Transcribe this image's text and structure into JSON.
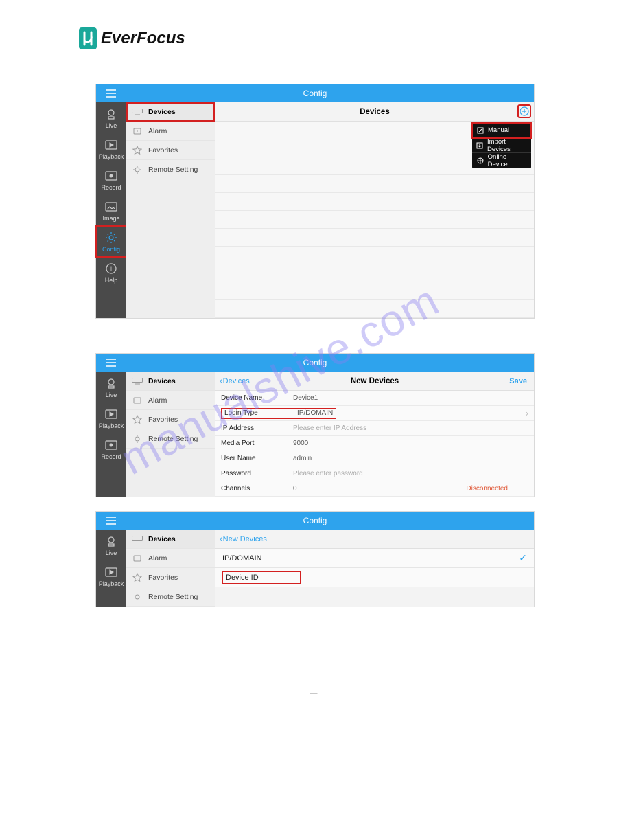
{
  "logo": {
    "text": "EverFocus"
  },
  "watermark": "manualshive.com",
  "app1": {
    "topbar_title": "Config",
    "nav": [
      {
        "label": "Live"
      },
      {
        "label": "Playback"
      },
      {
        "label": "Record"
      },
      {
        "label": "Image"
      },
      {
        "label": "Config"
      },
      {
        "label": "Help"
      }
    ],
    "settings": [
      {
        "label": "Devices"
      },
      {
        "label": "Alarm"
      },
      {
        "label": "Favorites"
      },
      {
        "label": "Remote Setting"
      }
    ],
    "main_title": "Devices",
    "popup": [
      {
        "label": "Manual"
      },
      {
        "label": "Import Devices"
      },
      {
        "label": "Online Device"
      }
    ]
  },
  "app2": {
    "topbar_title": "Config",
    "back_label": "Devices",
    "main_title": "New Devices",
    "save_label": "Save",
    "nav": [
      {
        "label": "Live"
      },
      {
        "label": "Playback"
      },
      {
        "label": "Record"
      }
    ],
    "settings": [
      {
        "label": "Devices"
      },
      {
        "label": "Alarm"
      },
      {
        "label": "Favorites"
      },
      {
        "label": "Remote Setting"
      }
    ],
    "form": {
      "device_name": {
        "label": "Device Name",
        "value": "Device1"
      },
      "login_type": {
        "label": "Login Type",
        "value": "IP/DOMAIN"
      },
      "ip_address": {
        "label": "IP Address",
        "placeholder": "Please enter IP Address"
      },
      "media_port": {
        "label": "Media Port",
        "value": "9000"
      },
      "user_name": {
        "label": "User Name",
        "value": "admin"
      },
      "password": {
        "label": "Password",
        "placeholder": "Please enter password"
      },
      "channels": {
        "label": "Channels",
        "value": "0",
        "status": "Disconnected"
      }
    }
  },
  "app3": {
    "topbar_title": "Config",
    "back_label": "New Devices",
    "nav": [
      {
        "label": "Live"
      },
      {
        "label": "Playback"
      }
    ],
    "settings": [
      {
        "label": "Devices"
      },
      {
        "label": "Alarm"
      },
      {
        "label": "Favorites"
      },
      {
        "label": "Remote Setting"
      }
    ],
    "options": [
      {
        "label": "IP/DOMAIN",
        "checked": true
      },
      {
        "label": "Device ID",
        "checked": false
      }
    ]
  }
}
